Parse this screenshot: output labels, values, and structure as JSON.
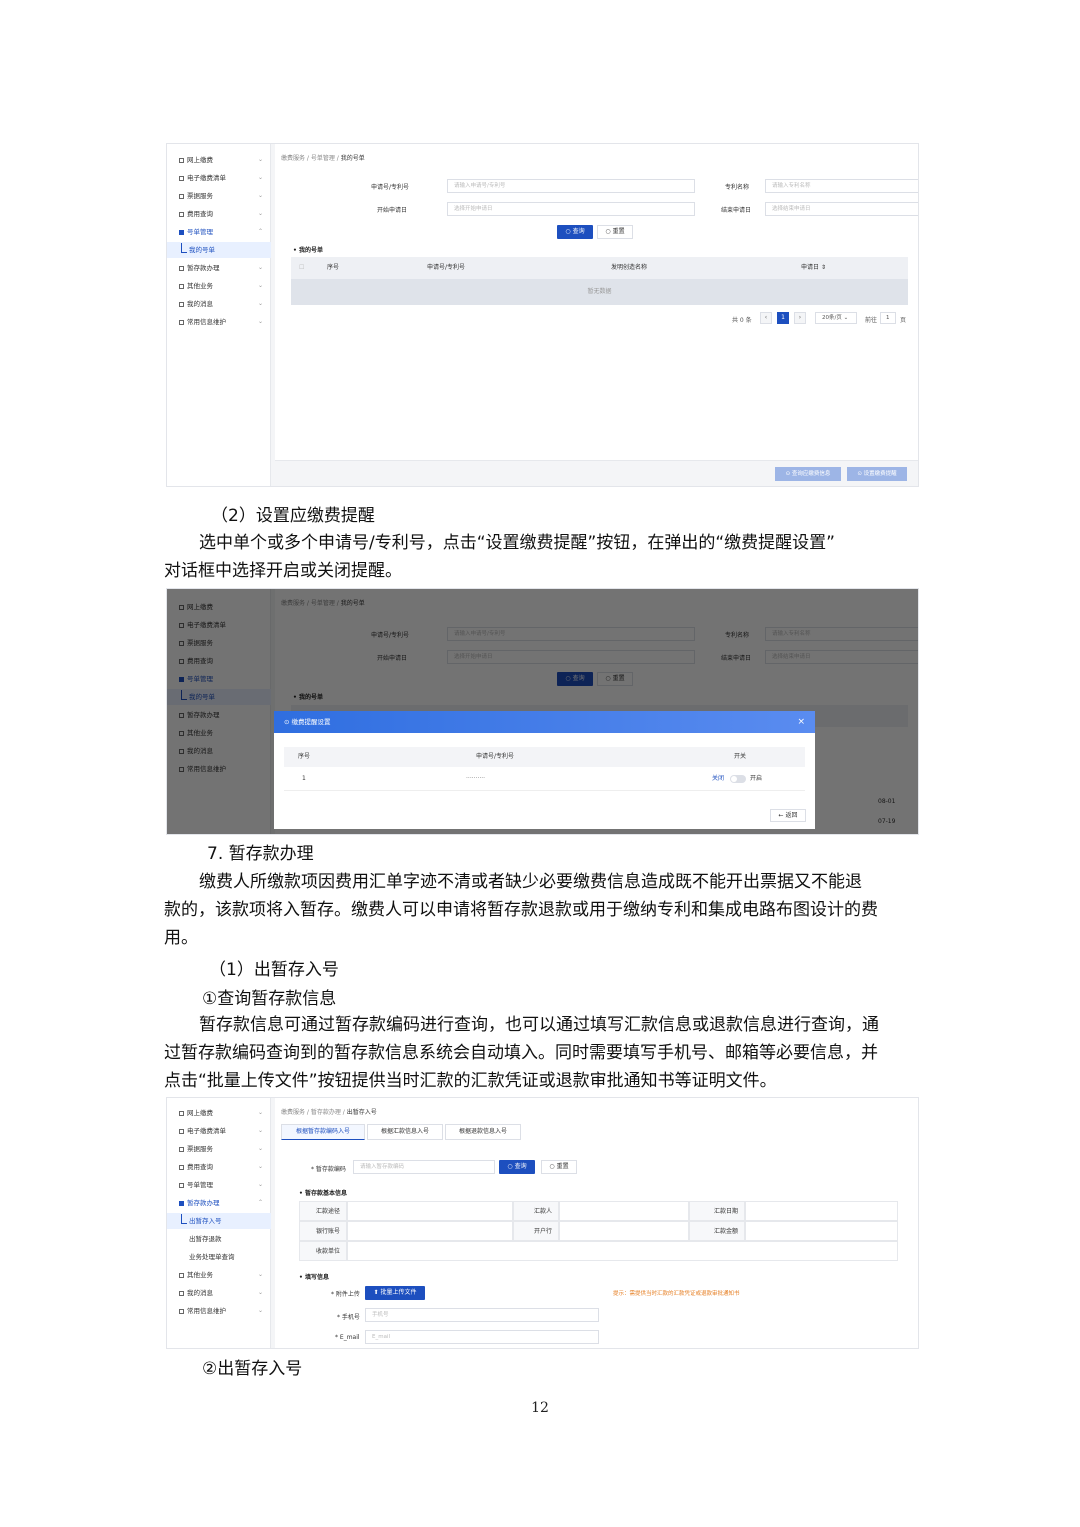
{
  "screenshot1": {
    "sidebar": [
      "网上缴费",
      "电子缴费清单",
      "票据服务",
      "费用查询",
      "号单管理",
      "我的号单",
      "暂存款办理",
      "其他业务",
      "我的消息",
      "常用信息维护"
    ],
    "breadcrumb": [
      "缴费服务",
      "号单管理",
      "我的号单"
    ],
    "labels": {
      "app_no": "申请号/专利号",
      "patent_name": "专利名称",
      "start_date": "开始申请日",
      "end_date": "结束申请日"
    },
    "placeholders": {
      "app_no": "请输入申请号/专利号",
      "patent_name": "请输入专利名称",
      "start_date": "选择开始申请日",
      "end_date": "选择结束申请日"
    },
    "buttons": {
      "search": "查询",
      "reset": "重置"
    },
    "section": "我的号单",
    "table_headers": [
      "序号",
      "申请号/专利号",
      "发明创造名称",
      "申请日"
    ],
    "empty_text": "暂无数据",
    "pager": {
      "total": "共 0 条",
      "current": "1",
      "size": "20条/页",
      "goto": "前往",
      "page_input": "1",
      "page_unit": "页"
    },
    "footer_buttons": [
      "查询应缴费信息",
      "设置缴费提醒"
    ]
  },
  "text1": "（2）设置应缴费提醒",
  "text2": "选中单个或多个申请号/专利号，点击“设置缴费提醒”按钮，在弹出的“缴费提醒设置”",
  "text3": "对话框中选择开启或关闭提醒。",
  "screenshot2": {
    "dialog_title": "缴费提醒设置",
    "close": "×",
    "headers": [
      "序号",
      "申请号/专利号",
      "开关"
    ],
    "row": {
      "index": "1",
      "app_no": "··········",
      "off": "关闭",
      "on": "开启"
    },
    "back": "返回",
    "bg_dates": [
      "08-01",
      "07-19"
    ]
  },
  "heading7": "7. 暂存款办理",
  "text4": "缴费人所缴款项因费用汇单字迹不清或者缺少必要缴费信息造成既不能开出票据又不能退",
  "text5": "款的，该款项将入暂存。缴费人可以申请将暂存款退款或用于缴纳专利和集成电路布图设计的费",
  "text6": "用。",
  "text7": "（1）出暂存入号",
  "text8": "①查询暂存款信息",
  "text9": "暂存款信息可通过暂存款编码进行查询，也可以通过填写汇款信息或退款信息进行查询，通",
  "text10": "过暂存款编码查询到的暂存款信息系统会自动填入。同时需要填写手机号、邮箱等必要信息，并",
  "text11": "点击“批量上传文件”按钮提供当时汇款的汇款凭证或退款审批通知书等证明文件。",
  "screenshot3": {
    "sidebar": [
      "网上缴费",
      "电子缴费清单",
      "票据服务",
      "费用查询",
      "号单管理",
      "暂存款办理",
      "出暂存入号",
      "出暂存退款",
      "业务处理单查询",
      "其他业务",
      "我的消息",
      "常用信息维护"
    ],
    "breadcrumb": [
      "缴费服务",
      "暂存款办理",
      "出暂存入号"
    ],
    "tabs": [
      "根据暂存款编码入号",
      "根据汇款信息入号",
      "根据退款信息入号"
    ],
    "code_label": "* 暂存款编码",
    "code_placeholder": "请输入暂存款编码",
    "buttons": {
      "search": "查询",
      "reset": "重置"
    },
    "section_basic": "暂存款基本信息",
    "grid": [
      [
        "汇款途径",
        "汇款人",
        "汇款日期"
      ],
      [
        "银行账号",
        "开户行",
        "汇款金额"
      ],
      [
        "收款单位"
      ]
    ],
    "section_fill": "填写信息",
    "attach_label": "* 附件上传",
    "upload_button": "批量上传文件",
    "hint": "提示：需提供当时汇款的汇款凭证或退款审批通知书",
    "phone_label": "* 手机号",
    "phone_placeholder": "手机号",
    "email_label": "* E_mail",
    "email_placeholder": "E_mail"
  },
  "text12": "②出暂存入号",
  "page_number": "12"
}
